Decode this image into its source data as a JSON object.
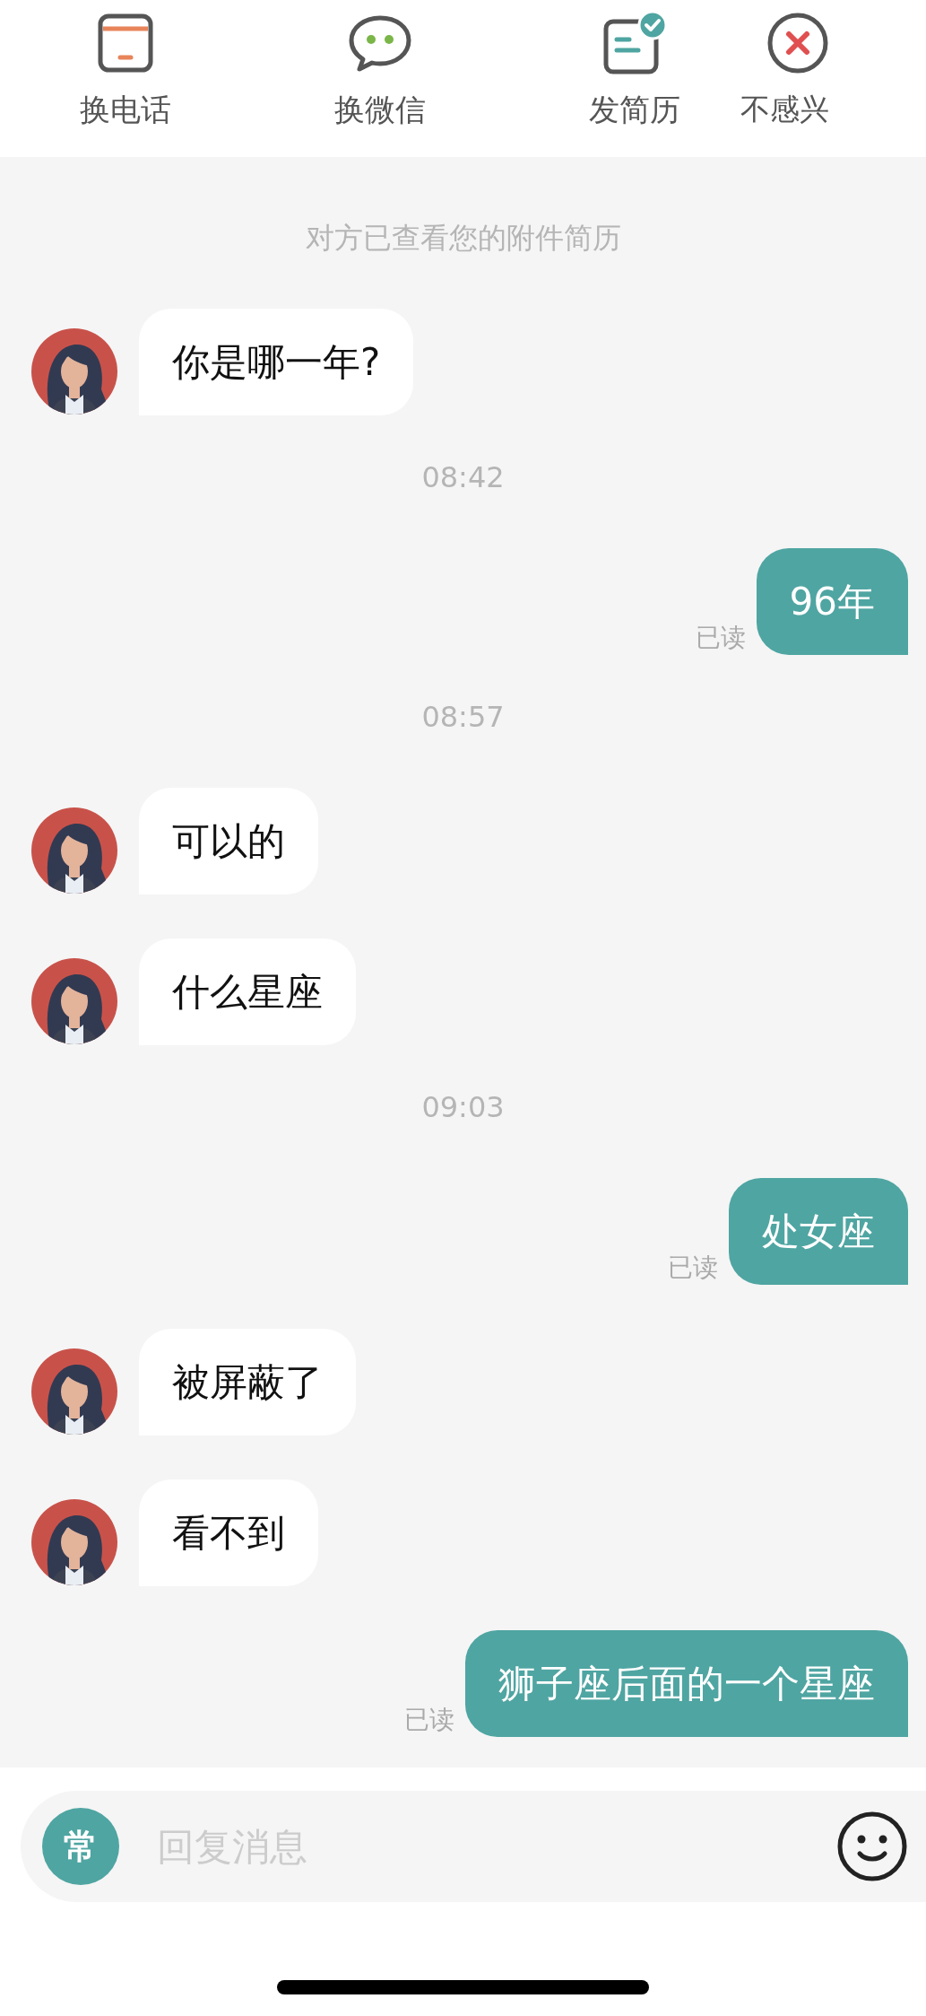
{
  "toolbar": [
    {
      "kind": "phone",
      "label": "换电话"
    },
    {
      "kind": "wechat",
      "label": "换微信"
    },
    {
      "kind": "resume",
      "label": "发简历"
    },
    {
      "kind": "decline",
      "label": "不感兴"
    }
  ],
  "messages": [
    {
      "kind": "notice",
      "text": "对方已查看您的附件简历"
    },
    {
      "kind": "incoming",
      "text": "你是哪一年?"
    },
    {
      "kind": "time",
      "text": "08:42"
    },
    {
      "kind": "outgoing",
      "text": "96年",
      "status": "已读"
    },
    {
      "kind": "time",
      "text": "08:57"
    },
    {
      "kind": "incoming",
      "text": "可以的"
    },
    {
      "kind": "incoming",
      "text": "什么星座"
    },
    {
      "kind": "time",
      "text": "09:03"
    },
    {
      "kind": "outgoing",
      "text": "处女座",
      "status": "已读"
    },
    {
      "kind": "incoming",
      "text": "被屏蔽了"
    },
    {
      "kind": "incoming",
      "text": "看不到"
    },
    {
      "kind": "outgoing",
      "text": "狮子座后面的一个星座",
      "status": "已读"
    }
  ],
  "composer": {
    "shortcut": "常",
    "placeholder": "回复消息"
  }
}
